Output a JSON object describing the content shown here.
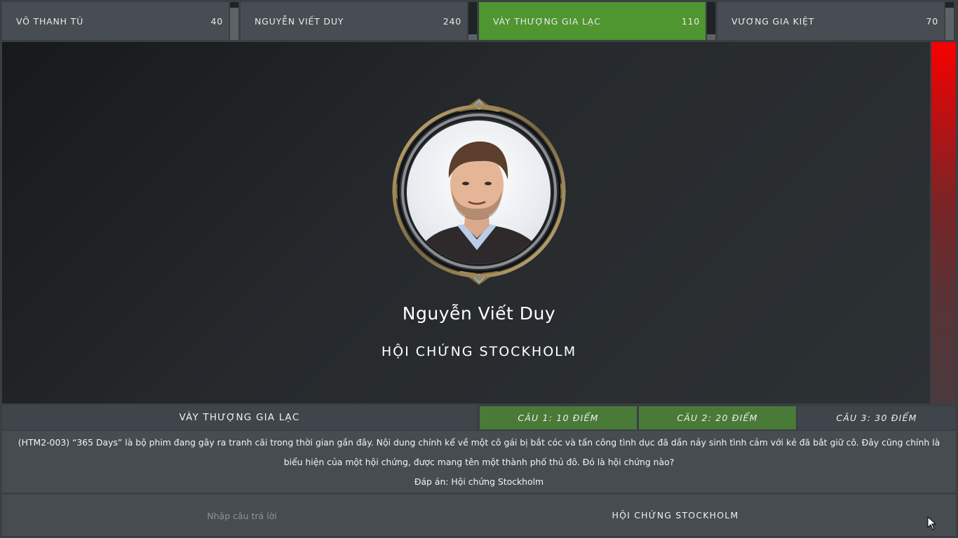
{
  "players": [
    {
      "name": "VÕ THANH TÚ",
      "score": "40",
      "active": false,
      "timer_level": 0.15
    },
    {
      "name": "NGUYỄN VIẾT DUY",
      "score": "240",
      "active": false,
      "timer_level": 0.85
    },
    {
      "name": "VÀY THƯỢNG GIA LẠC",
      "score": "110",
      "active": true,
      "timer_level": 0.85
    },
    {
      "name": "VƯƠNG GIA KIỆT",
      "score": "70",
      "active": false,
      "timer_level": 0.15
    }
  ],
  "stage": {
    "player_name": "Nguyễn Viết Duy",
    "answer": "HỘI CHỨNG STOCKHOLM",
    "timer_color": "#f80000"
  },
  "question_bar": {
    "current_player": "VÀY THƯỢNG GIA LẠC",
    "options": [
      {
        "label": "CÂU 1: 10 ĐIỂM",
        "used": true
      },
      {
        "label": "CÂU 2: 20 ĐIỂM",
        "used": true
      },
      {
        "label": "CÂU 3: 30 ĐIỂM",
        "used": false
      }
    ]
  },
  "question": {
    "text": "(HTM2-003) “365 Days” là bộ phim đang gây ra tranh cãi trong thời gian gần đây. Nội dung chính kể về một cô gái bị bắt cóc và tấn công tình dục đã dần nảy sinh tình cảm với kẻ đã bắt giữ cô. Đây cũng chính là biểu hiện của một hội chứng, được mang tên một thành phố thủ đô. Đó là hội chứng nào?",
    "answer_line": "Đáp án: Hội chứng Stockholm"
  },
  "input": {
    "placeholder": "Nhập câu trả lời",
    "value": "",
    "submitted": "HỘI CHỨNG STOCKHOLM"
  },
  "colors": {
    "active_player": "#4f9530",
    "used_option": "#4a7a38",
    "panel": "#474c51"
  }
}
